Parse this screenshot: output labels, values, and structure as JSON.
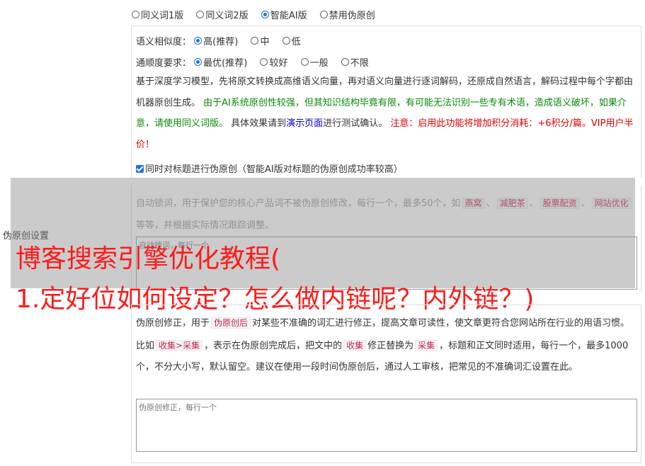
{
  "mode_options": [
    {
      "label": "同义词1版",
      "selected": false
    },
    {
      "label": "同义词2版",
      "selected": false
    },
    {
      "label": "智能AI版",
      "selected": true
    },
    {
      "label": "禁用伪原创",
      "selected": false
    }
  ],
  "similarity": {
    "label": "语义相似度：",
    "options": [
      {
        "label": "高(推荐)",
        "selected": true
      },
      {
        "label": "中",
        "selected": false
      },
      {
        "label": "低",
        "selected": false
      }
    ]
  },
  "fluency": {
    "label": "通顺度要求：",
    "options": [
      {
        "label": "最优(推荐)",
        "selected": true
      },
      {
        "label": "较好",
        "selected": false
      },
      {
        "label": "一般",
        "selected": false
      },
      {
        "label": "不限",
        "selected": false
      }
    ]
  },
  "desc": {
    "p1": "基于深度学习模型，先将原文转换成高维语义向量，再对语义向量进行逐词解码，还原成自然语言，解码过程中每个字都由机器原创生成。",
    "p2": "由于AI系统原创性较强，但其知识结构毕竟有限，有可能无法识别一些专有术语，造成语义破坏，如果介意，请使用同义词版。",
    "p3a": "具体效果请到",
    "p3link": "演示页面",
    "p3b": "进行测试确认。",
    "p4": "注意：启用此功能将增加积分消耗：+6积分/篇。VIP用户半价！"
  },
  "title_check": {
    "label": "同时对标题进行伪原创（智能AI版对标题的伪原创成功率较高）",
    "checked": true
  },
  "lock": {
    "text_a": "自动锁词，用于保护您的核心产品词不被伪原创修改，每行一个，最多50个，如",
    "tags": [
      "燕窝",
      "减肥茶",
      "股票配资",
      "网站优化"
    ],
    "text_b": "等等，并根据实际情况跟踪调整。",
    "placeholder": "自动锁词，每行一个"
  },
  "side_label": "伪原创设置",
  "fix": {
    "t1": "伪原创修正，用于",
    "tag1": "伪原创后",
    "t2": "对某些不准确的词汇进行修正，提高文章可读性，使文章更符合您网站所在行业的用语习惯。比如",
    "tag2": "收集>采集",
    "t3": "，表示在伪原创完成后，把文中的",
    "tag3": "收集",
    "t4": "修正替换为",
    "tag4": "采集",
    "t5": "，标题和正文同时适用，每行一个，最多1000个，不分大小写，默认留空。建议在使用一段时间伪原创后，通过人工审核，把常见的不准确词汇设置在此。",
    "placeholder": "伪原创修正，每行一个"
  },
  "headline": {
    "line1": "博客搜索引擎优化教程(",
    "line2": "1.定好位如何设定？怎么做内链呢？内外链？)"
  },
  "colors": {
    "accent": "#1a73e8",
    "headline": "#ff1a1a",
    "green": "#0a8a0a",
    "red": "#e00000"
  }
}
